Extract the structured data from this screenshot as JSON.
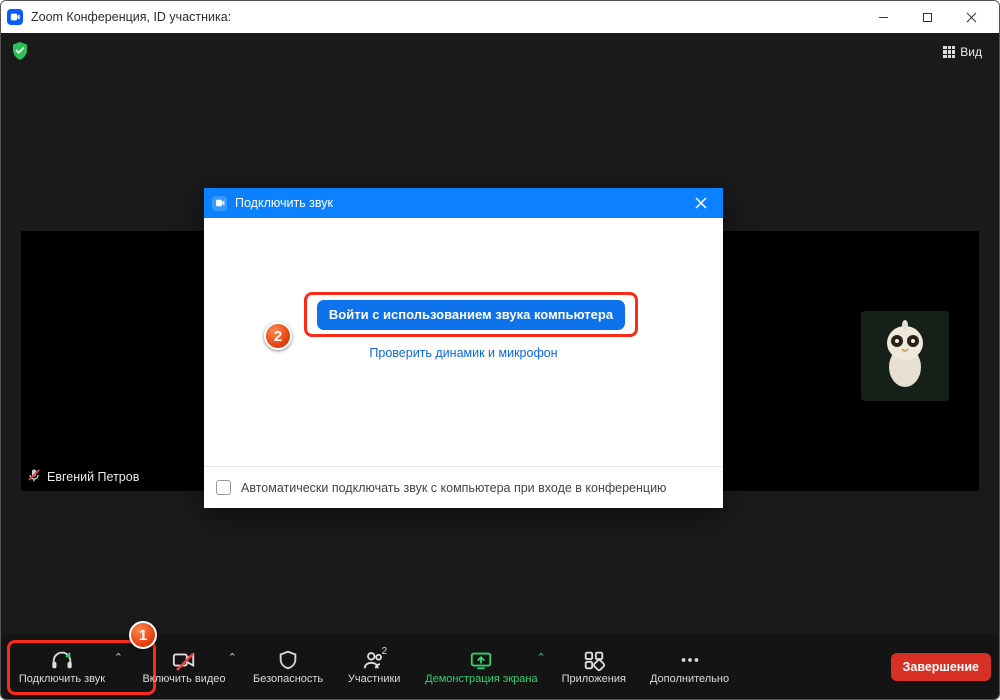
{
  "window": {
    "title": "Zoom Конференция, ID участника:"
  },
  "topbar": {
    "view_label": "Вид"
  },
  "participant": {
    "name": "Евгений Петров"
  },
  "dialog": {
    "title": "Подключить звук",
    "primary_button": "Войти с использованием звука компьютера",
    "test_link": "Проверить динамик и микрофон",
    "auto_connect_label": "Автоматически подключать звук с компьютера при входе в конференцию"
  },
  "toolbar": {
    "audio": "Подключить звук",
    "video": "Включить видео",
    "security": "Безопасность",
    "participants": "Участники",
    "participants_count": "2",
    "share": "Демонстрация экрана",
    "apps": "Приложения",
    "more": "Дополнительно",
    "end": "Завершение"
  },
  "annotations": {
    "step1": "1",
    "step2": "2"
  }
}
